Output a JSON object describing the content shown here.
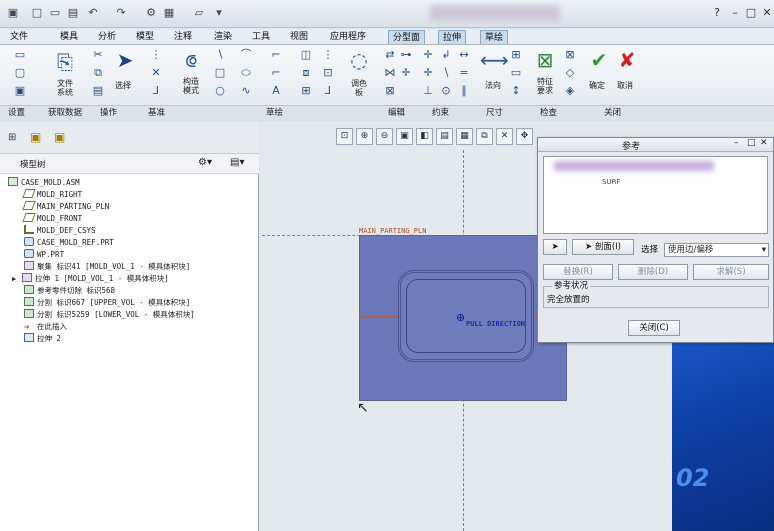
{
  "ribbon_tabs": [
    "文件",
    "模具",
    "分析",
    "模型",
    "注释",
    "渲染",
    "工具",
    "视图",
    "应用程序",
    "分型面",
    "拉伸",
    "草绘"
  ],
  "ribbon": {
    "file_system": "文件\n系统",
    "select": "选择",
    "construction_mode": "构造\n模式",
    "palette": "调色\n板",
    "normal": "法向",
    "feature_requirements": "特征\n要求",
    "ok": "确定",
    "cancel": "取消"
  },
  "groups": [
    "设置",
    "获取数据",
    "操作",
    "基准",
    "草绘",
    "编辑",
    "约束",
    "尺寸",
    "检查",
    "关闭"
  ],
  "model_tree": {
    "title": "模型树",
    "items": [
      "CASE_MOLD.ASM",
      "MOLD_RIGHT",
      "MAIN_PARTING_PLN",
      "MOLD_FRONT",
      "MOLD_DEF_CSYS",
      "CASE_MOLD_REF.PRT",
      "WP.PRT",
      "聚集 标识41 [MOLD_VOL_1 - 模具体积块]",
      "拉伸 1 [MOLD_VOL_1 - 模具体积块]",
      "参考零件切除 标识568",
      "分割 标识667 [UPPER_VOL - 模具体积块]",
      "分割 标识5259 [LOWER_VOL - 模具体积块]",
      "在此插入",
      "拉伸 2"
    ]
  },
  "canvas": {
    "plane_label": "MAIN_PARTING_PLN",
    "pull_direction": "PULL DIRECTION"
  },
  "dialog": {
    "title": "参考",
    "item_text": "SURF",
    "section_button": "剖面(I)",
    "select_label": "选择",
    "select_value": "使用边/偏移",
    "replace": "替换(R)",
    "delete": "删除(D)",
    "solve": "求解(S)",
    "status_title": "参考状况",
    "status_value": "完全放置的",
    "close": "关闭(C)"
  },
  "desktop_number": "02"
}
